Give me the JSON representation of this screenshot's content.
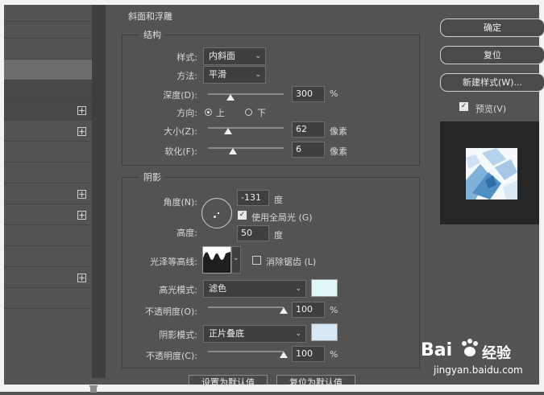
{
  "colors": {
    "background": "#535353",
    "field": "#3f3f3f",
    "highlight_swatch": "#e0f7f8",
    "shadow_swatch": "#d6e7f5",
    "selected_row": "#6d6d6d",
    "dark_row": "#484848"
  },
  "left_list": {
    "rows": [
      {
        "plus": ""
      },
      {
        "plus": ""
      },
      {
        "plus": ""
      },
      {
        "plus": ""
      },
      {
        "plus": ""
      },
      {
        "plus": "+"
      },
      {
        "plus": "+"
      },
      {
        "plus": ""
      },
      {
        "plus": ""
      },
      {
        "plus": "+"
      },
      {
        "plus": "+"
      },
      {
        "plus": ""
      },
      {
        "plus": ""
      },
      {
        "plus": "+"
      },
      {
        "plus": ""
      }
    ]
  },
  "panel": {
    "title": "斜面和浮雕",
    "structure": {
      "title": "结构",
      "style_label": "样式:",
      "style_value": "内斜面",
      "technique_label": "方法:",
      "technique_value": "平滑",
      "depth_label": "深度(D):",
      "depth_value": "300",
      "depth_unit": "%",
      "depth_level": 0.3,
      "direction_label": "方向:",
      "direction_up": "上",
      "direction_down": "下",
      "size_label": "大小(Z):",
      "size_value": "62",
      "size_unit": "像素",
      "size_level": 0.27,
      "soften_label": "软化(F):",
      "soften_value": "6",
      "soften_unit": "像素",
      "soften_level": 0.33
    },
    "shading": {
      "title": "阴影",
      "angle_label": "角度(N):",
      "angle_value": "-131",
      "angle_unit": "度",
      "global_light_label": "使用全局光 (G)",
      "altitude_label": "高度:",
      "altitude_value": "50",
      "altitude_unit": "度",
      "gloss_label": "光泽等高线:",
      "antialias_label": "消除锯齿 (L)",
      "highlight_mode_label": "高光模式:",
      "highlight_mode_value": "滤色",
      "highlight_opacity_label": "不透明度(O):",
      "highlight_opacity_value": "100",
      "highlight_opacity_unit": "%",
      "highlight_opacity_level": 1.0,
      "shadow_mode_label": "阴影模式:",
      "shadow_mode_value": "正片叠底",
      "shadow_opacity_label": "不透明度(C):",
      "shadow_opacity_value": "100",
      "shadow_opacity_unit": "%",
      "shadow_opacity_level": 1.0
    },
    "make_default": "设置为默认值",
    "reset_default": "复位为默认值"
  },
  "right": {
    "ok": "确定",
    "reset": "复位",
    "new_style": "新建样式(W)...",
    "preview_label": "预览(V)"
  },
  "watermark": {
    "brand": "Bai",
    "brand2": "经验",
    "url": "jingyan.baidu.com"
  }
}
